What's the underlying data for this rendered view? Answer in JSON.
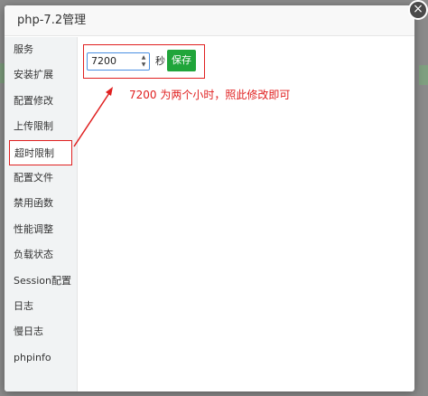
{
  "dialog": {
    "title": "php-7.2管理",
    "close_glyph": "×"
  },
  "sidebar": {
    "items": [
      {
        "label": "服务"
      },
      {
        "label": "安装扩展"
      },
      {
        "label": "配置修改"
      },
      {
        "label": "上传限制"
      },
      {
        "label": "超时限制"
      },
      {
        "label": "配置文件"
      },
      {
        "label": "禁用函数"
      },
      {
        "label": "性能调整"
      },
      {
        "label": "负载状态"
      },
      {
        "label": "Session配置"
      },
      {
        "label": "日志"
      },
      {
        "label": "慢日志"
      },
      {
        "label": "phpinfo"
      }
    ],
    "active_index": 4
  },
  "timeout": {
    "value": "7200",
    "unit": "秒",
    "save_label": "保存"
  },
  "annotation": {
    "text": "7200 为两个小时，照此修改即可",
    "color": "#e02020"
  },
  "colors": {
    "save_button": "#20a53a",
    "highlight": "#e02020",
    "input_focus": "#4a90e2"
  },
  "icons": [
    "close-icon",
    "spinner-up-icon",
    "spinner-down-icon",
    "arrow-annotation-icon"
  ]
}
